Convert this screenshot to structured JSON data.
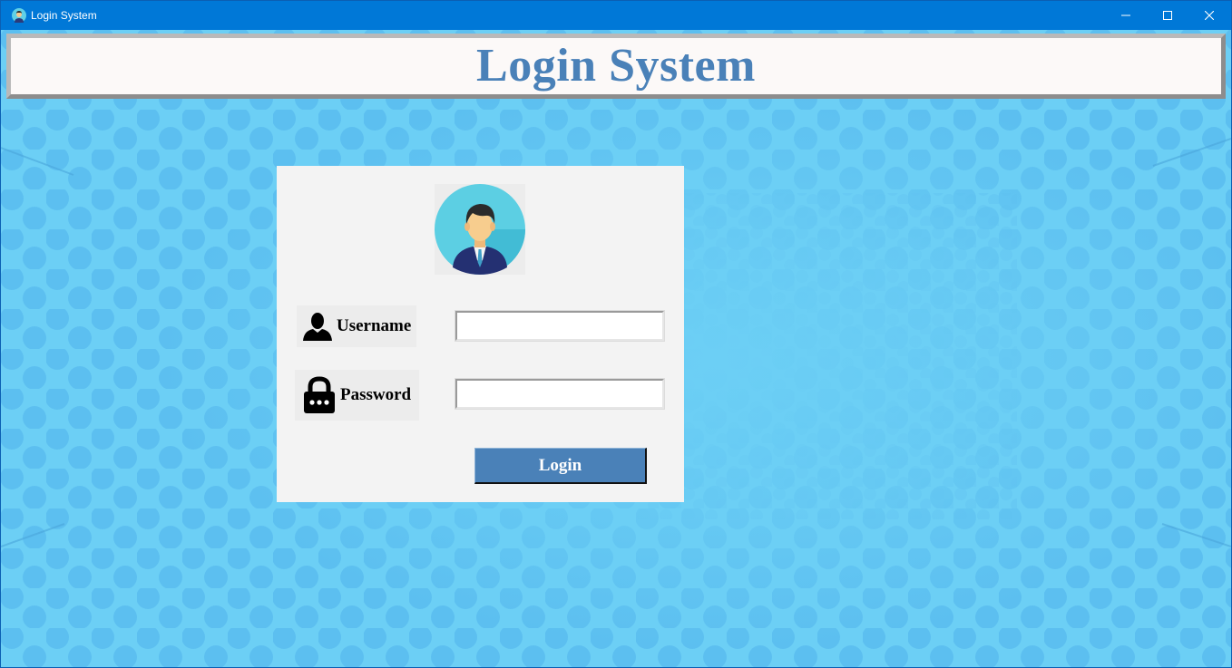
{
  "window": {
    "title": "Login System",
    "icon": "user-avatar-icon",
    "controls": [
      "minimize-icon",
      "maximize-icon",
      "close-icon"
    ],
    "titlebar_color": "#0078d7"
  },
  "header": {
    "title": "Login System",
    "title_color": "#4a81b8"
  },
  "background": {
    "color": "#6ccff5",
    "pattern": "dot-pattern"
  },
  "login_panel": {
    "avatar_icon": "user-avatar-icon",
    "username": {
      "label": "Username",
      "icon": "person-icon",
      "value": ""
    },
    "password": {
      "label": "Password",
      "icon": "padlock-icon",
      "value": ""
    },
    "login_button": {
      "label": "Login",
      "color": "#4a81b8"
    }
  }
}
